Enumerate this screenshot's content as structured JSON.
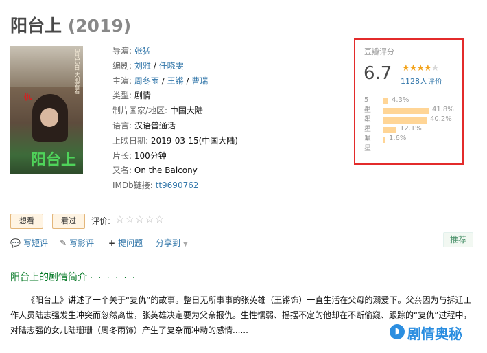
{
  "movie": {
    "title": "阳台上",
    "year": "(2019)"
  },
  "poster": {
    "title_text": "阳台上",
    "date_text": "3月15日 大胆看看"
  },
  "info": {
    "director_label": "导演:",
    "director": "张猛",
    "writer_label": "编剧:",
    "writer_1": "刘雅",
    "writer_sep": " / ",
    "writer_2": "任晓雯",
    "cast_label": "主演:",
    "cast_1": "周冬雨",
    "cast_2": "王锵",
    "cast_3": "曹瑞",
    "genre_label": "类型:",
    "genre": "剧情",
    "country_label": "制片国家/地区:",
    "country": "中国大陆",
    "language_label": "语言:",
    "language": "汉语普通话",
    "release_label": "上映日期:",
    "release": "2019-03-15(中国大陆)",
    "runtime_label": "片长:",
    "runtime": "100分钟",
    "aka_label": "又名:",
    "aka": "On the Balcony",
    "imdb_label": "IMDb链接:",
    "imdb": "tt9690762"
  },
  "rating": {
    "label": "豆瓣评分",
    "score": "6.7",
    "stars": 3.5,
    "count": "1128人评价",
    "rows": [
      {
        "star": "5星",
        "pct": "4.3%",
        "value": 4.3
      },
      {
        "star": "4星",
        "pct": "41.8%",
        "value": 41.8
      },
      {
        "star": "3星",
        "pct": "40.2%",
        "value": 40.2
      },
      {
        "star": "2星",
        "pct": "12.1%",
        "value": 12.1
      },
      {
        "star": "1星",
        "pct": "1.6%",
        "value": 1.6
      }
    ]
  },
  "actions": {
    "want": "想看",
    "watched": "看过",
    "rate_label": "评价:",
    "rate_stars": "☆☆☆☆☆"
  },
  "tools": {
    "short_review": "写短评",
    "review": "写影评",
    "question": "提问题",
    "share": "分享到",
    "recommend": "推荐"
  },
  "synopsis": {
    "heading": "阳台上的剧情简介",
    "dots": "· · · · · ·",
    "text": "《阳台上》讲述了一个关于“复仇”的故事。整日无所事事的张英雄（王锵饰）一直生活在父母的溺爱下。父亲因为与拆迁工作人员陆志强发生冲突而忽然离世，张英雄决定要为父亲报仇。生性懦弱、摇摆不定的他却在不断偷窥、跟踪的“复仇”过程中，对陆志强的女儿陆珊珊（周冬雨饰）产生了复杂而冲动的感情......"
  },
  "watermark": {
    "text": "剧情奥秘"
  },
  "colors": {
    "link": "#3377aa",
    "star": "#f3a31b",
    "bar": "#ffd596",
    "highlight_border": "#e32b2b",
    "section_green": "#007722"
  }
}
